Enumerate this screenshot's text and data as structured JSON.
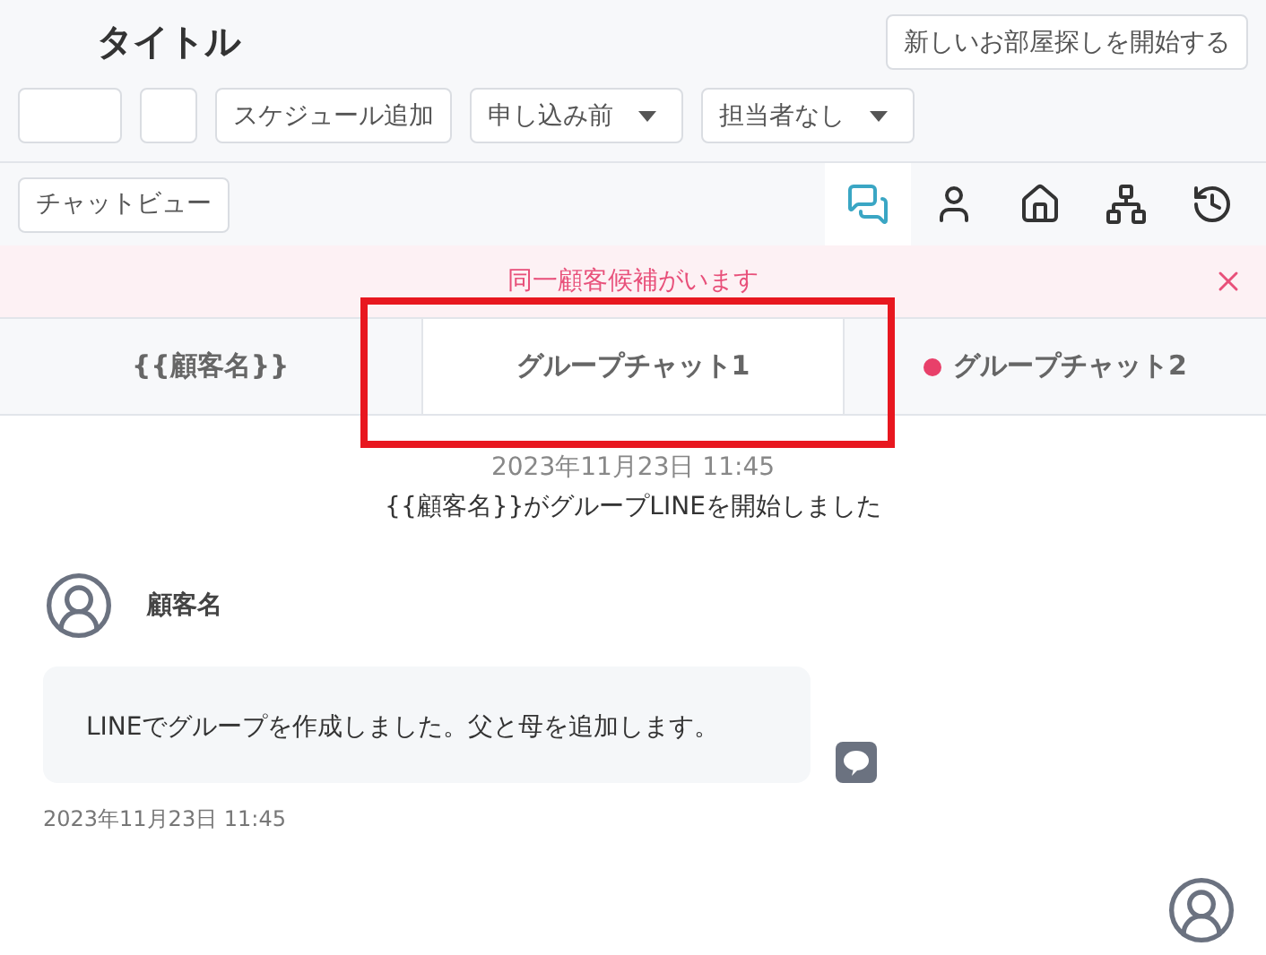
{
  "header": {
    "title": "タイトル",
    "new_search_button": "新しいお部屋探しを開始する"
  },
  "toolbar": {
    "schedule_button": "スケジュール追加",
    "status_select": "申し込み前",
    "assignee_select": "担当者なし"
  },
  "view_bar": {
    "chat_view_button": "チャットビュー",
    "icons": [
      {
        "kind": "chat",
        "selected": true
      },
      {
        "kind": "person",
        "selected": false
      },
      {
        "kind": "building",
        "selected": false
      },
      {
        "kind": "tree",
        "selected": false
      },
      {
        "kind": "history",
        "selected": false
      }
    ]
  },
  "alert": {
    "text": "同一顧客候補がいます"
  },
  "tabs": [
    {
      "label": "{{顧客名}}",
      "selected": false,
      "unread": false
    },
    {
      "label": "グループチャット1",
      "selected": true,
      "unread": false
    },
    {
      "label": "グループチャット2",
      "selected": false,
      "unread": true
    }
  ],
  "system_message": {
    "time": "2023年11月23日 11:45",
    "text": "{{顧客名}}がグループLINEを開始しました"
  },
  "messages": [
    {
      "sender": "顧客名",
      "text": "LINEでグループを作成しました。父と母を追加します。",
      "time": "2023年11月23日 11:45",
      "via_line": true
    }
  ]
}
